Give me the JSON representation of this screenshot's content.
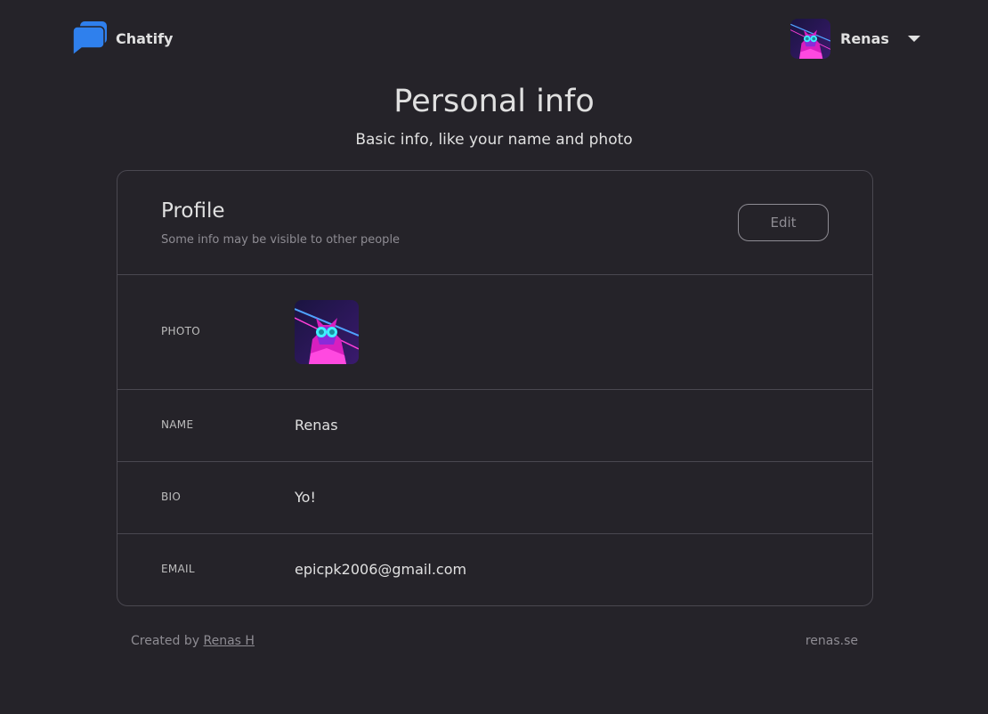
{
  "brand": {
    "name": "Chatify",
    "logo_color": "#2f80ed"
  },
  "user_menu": {
    "name": "Renas",
    "avatar_icon": "neon-cat-avatar"
  },
  "page": {
    "title": "Personal info",
    "subtitle": "Basic info, like your name and photo"
  },
  "profile": {
    "title": "Profile",
    "note": "Some info may be visible to other people",
    "edit_label": "Edit",
    "fields": {
      "photo_label": "PHOTO",
      "name_label": "NAME",
      "name_value": "Renas",
      "bio_label": "BIO",
      "bio_value": "Yo!",
      "email_label": "EMAIL",
      "email_value": "epicpk2006@gmail.com"
    }
  },
  "footer": {
    "created_by": "Created by",
    "author_link": "Renas H",
    "site": "renas.se"
  },
  "colors": {
    "background": "#252329",
    "border": "#4a4850",
    "muted_text": "#8e8c93",
    "text": "#e0e0e0"
  }
}
